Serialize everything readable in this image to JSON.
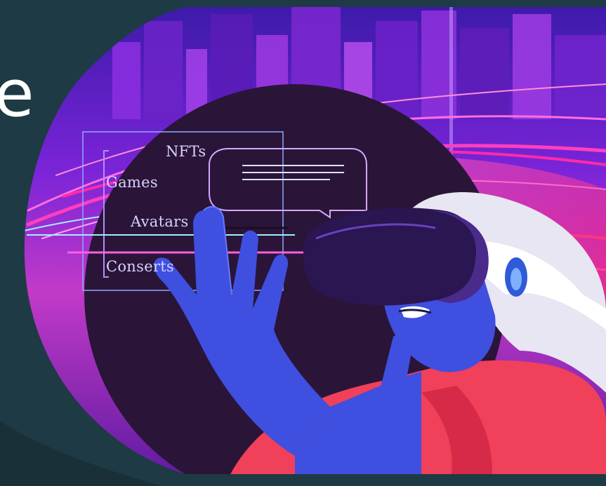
{
  "slide": {
    "background_color": "#ffffff",
    "panel_color": "#1e3a44",
    "heading_fragment_top": "e",
    "heading_fragment_bottom": ""
  },
  "illustration": {
    "menu_items": [
      "NFTs",
      "Games",
      "Avatars",
      "Conserts"
    ],
    "colors": {
      "sky_purple": "#6a1fd0",
      "neon_pink": "#ff2bb8",
      "vr_headset": "#2a1650",
      "helmet": "#e8e6f2",
      "skin_blue": "#3f4fe0",
      "shirt_red": "#f0405a",
      "dark_circle": "#2a1538",
      "hud_line": "#b68cf5"
    }
  }
}
